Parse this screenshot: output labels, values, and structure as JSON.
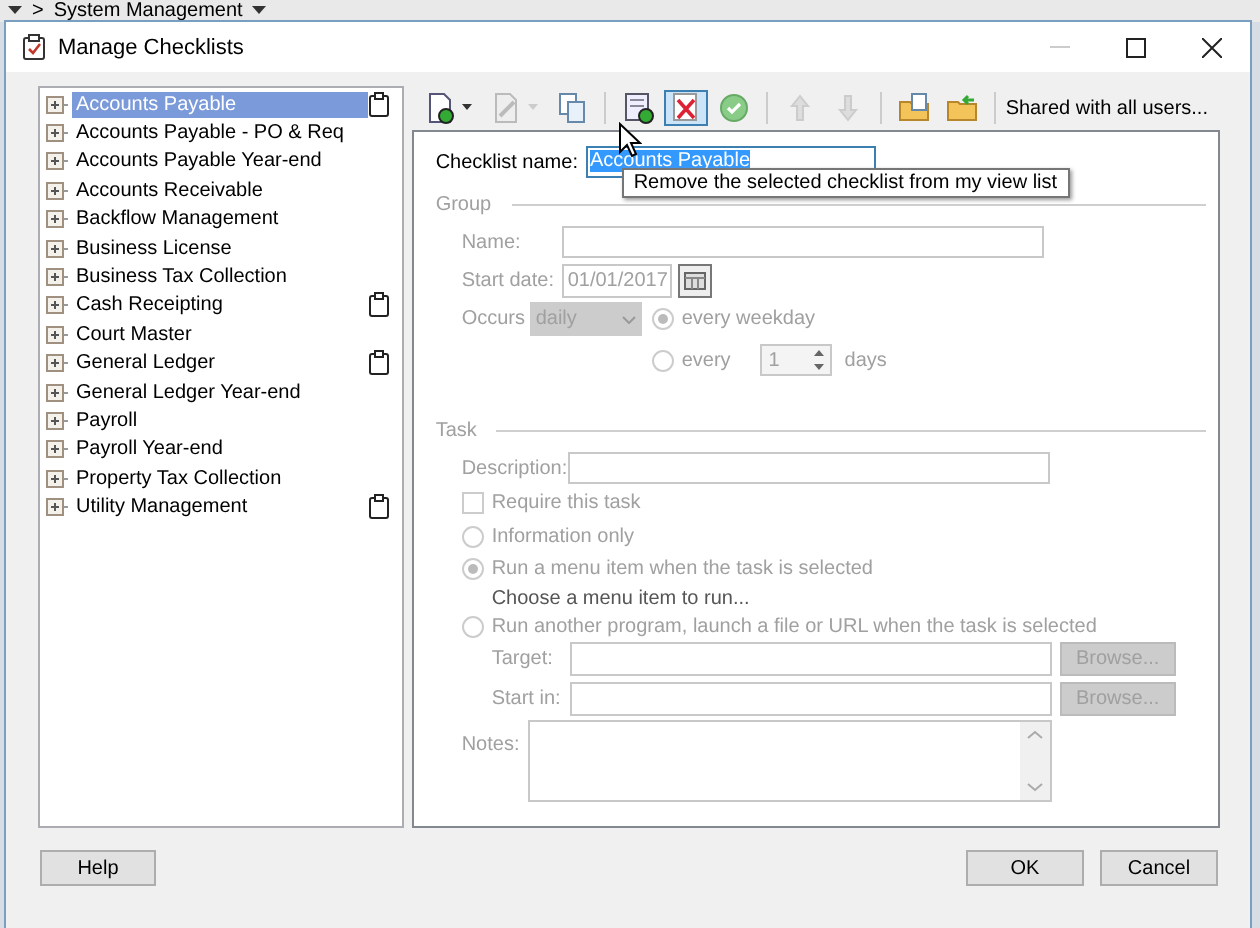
{
  "app_bar": {
    "breadcrumb": ">",
    "menu": "System Management"
  },
  "window": {
    "title": "Manage Checklists"
  },
  "checklists": [
    {
      "label": "Accounts Payable",
      "selected": true,
      "clipboard": true
    },
    {
      "label": "Accounts Payable - PO & Req",
      "selected": false,
      "clipboard": false
    },
    {
      "label": "Accounts Payable Year-end",
      "selected": false,
      "clipboard": false
    },
    {
      "label": "Accounts Receivable",
      "selected": false,
      "clipboard": false
    },
    {
      "label": "Backflow Management",
      "selected": false,
      "clipboard": false
    },
    {
      "label": "Business License",
      "selected": false,
      "clipboard": false
    },
    {
      "label": "Business Tax Collection",
      "selected": false,
      "clipboard": false
    },
    {
      "label": "Cash Receipting",
      "selected": false,
      "clipboard": true
    },
    {
      "label": "Court Master",
      "selected": false,
      "clipboard": false
    },
    {
      "label": "General Ledger",
      "selected": false,
      "clipboard": true
    },
    {
      "label": "General Ledger Year-end",
      "selected": false,
      "clipboard": false
    },
    {
      "label": "Payroll",
      "selected": false,
      "clipboard": false
    },
    {
      "label": "Payroll Year-end",
      "selected": false,
      "clipboard": false
    },
    {
      "label": "Property Tax Collection",
      "selected": false,
      "clipboard": false
    },
    {
      "label": "Utility Management",
      "selected": false,
      "clipboard": true
    }
  ],
  "toolbar": {
    "items": [
      {
        "kind": "new",
        "disabled": false,
        "pressed": false,
        "dropdown": true
      },
      {
        "kind": "edit",
        "disabled": true,
        "pressed": false,
        "dropdown": true
      },
      {
        "kind": "copy",
        "disabled": false,
        "pressed": false,
        "dropdown": false
      },
      {
        "kind": "separator"
      },
      {
        "kind": "add-item",
        "disabled": false,
        "pressed": false,
        "dropdown": false
      },
      {
        "kind": "remove",
        "disabled": false,
        "pressed": true,
        "dropdown": false
      },
      {
        "kind": "approve",
        "disabled": false,
        "pressed": false,
        "dropdown": false
      },
      {
        "kind": "separator"
      },
      {
        "kind": "move-up",
        "disabled": true,
        "pressed": false,
        "dropdown": false
      },
      {
        "kind": "move-down",
        "disabled": true,
        "pressed": false,
        "dropdown": false
      },
      {
        "kind": "separator"
      },
      {
        "kind": "export",
        "disabled": false,
        "pressed": false,
        "dropdown": false
      },
      {
        "kind": "import",
        "disabled": false,
        "pressed": false,
        "dropdown": false
      },
      {
        "kind": "separator"
      }
    ],
    "shared": "Shared with all users..."
  },
  "tooltip": "Remove the selected checklist from my view list",
  "form": {
    "checklist_name_label": "Checklist name:",
    "checklist_name": "Accounts Payable",
    "name_selected": true,
    "group": {
      "title": "Group",
      "disabled": true,
      "name_label": "Name:",
      "start_date_label": "Start date:",
      "start_date": "01/01/2017",
      "occurs_label": "Occurs",
      "occurs": "daily",
      "options": [
        {
          "label": "every weekday",
          "selected": true
        },
        {
          "label": "every",
          "selected": false,
          "count": "1",
          "unit": "days"
        }
      ]
    },
    "task": {
      "title": "Task",
      "disabled": true,
      "description_label": "Description:",
      "require": {
        "label": "Require this task",
        "checked": false
      },
      "modes": [
        {
          "label": "Information only",
          "selected": false
        },
        {
          "label": "Run a menu item when the task is selected",
          "selected": true,
          "hint": "Choose a menu item to run..."
        },
        {
          "label": "Run another program, launch a file or URL when the task is selected",
          "selected": false
        }
      ],
      "paths": [
        {
          "label": "Target:",
          "button": "Browse..."
        },
        {
          "label": "Start in:",
          "button": "Browse..."
        }
      ],
      "notes_label": "Notes:"
    }
  },
  "buttons": {
    "help": "Help",
    "ok": "OK",
    "cancel": "Cancel"
  }
}
